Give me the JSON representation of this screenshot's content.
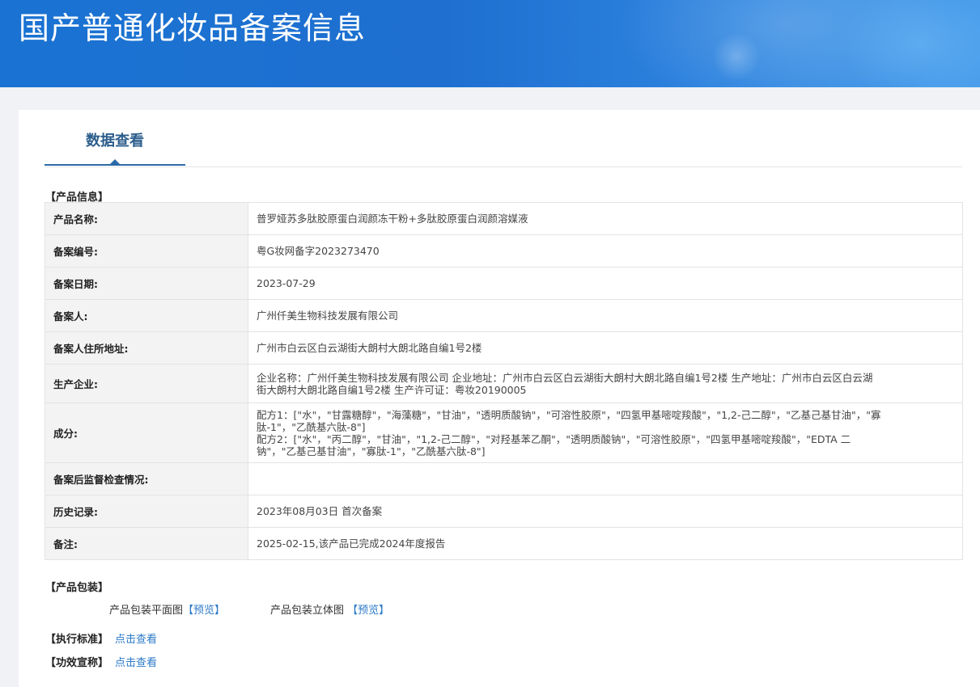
{
  "header": {
    "title": "国产普通化妆品备案信息"
  },
  "tabs": {
    "active_label": "数据查看"
  },
  "product_info": {
    "section_title": "【产品信息】",
    "rows": [
      {
        "label": "产品名称:",
        "value": "普罗娅苏多肽胶原蛋白润颜冻干粉+多肽胶原蛋白润颜溶媒液"
      },
      {
        "label": "备案编号:",
        "value": "粤G妆网备字2023273470"
      },
      {
        "label": "备案日期:",
        "value": "2023-07-29"
      },
      {
        "label": "备案人:",
        "value": "广州仟美生物科技发展有限公司"
      },
      {
        "label": "备案人住所地址:",
        "value": "广州市白云区白云湖街大朗村大朗北路自编1号2楼"
      },
      {
        "label": "生产企业:",
        "value_lines": [
          "企业名称：广州仟美生物科技发展有限公司 企业地址：广州市白云区白云湖街大朗村大朗北路自编1号2楼 生产地址：广州市白云区白云湖",
          "街大朗村大朗北路自编1号2楼 生产许可证：粤妆20190005"
        ]
      },
      {
        "label": "成分:",
        "value_lines": [
          "配方1：[\"水\"，\"甘露糖醇\"，\"海藻糖\"，\"甘油\"，\"透明质酸钠\"，\"可溶性胶原\"，\"四氢甲基嘧啶羧酸\"，\"1,2-己二醇\"，\"乙基己基甘油\"，\"寡",
          "肽-1\"，\"乙酰基六肽-8\"]",
          "配方2：[\"水\"，\"丙二醇\"，\"甘油\"，\"1,2-己二醇\"，\"对羟基苯乙酮\"，\"透明质酸钠\"，\"可溶性胶原\"，\"四氢甲基嘧啶羧酸\"，\"EDTA 二",
          "钠\"，\"乙基己基甘油\"，\"寡肽-1\"，\"乙酰基六肽-8\"]"
        ]
      },
      {
        "label": "备案后监督检查情况:",
        "value": ""
      },
      {
        "label": "历史记录:",
        "value": "2023年08月03日 首次备案"
      },
      {
        "label": "备注:",
        "value": "2025-02-15,该产品已完成2024年度报告"
      }
    ]
  },
  "packaging": {
    "section_title": "【产品包装】",
    "flat_label": "产品包装平面图",
    "flat_link": "【预览】",
    "solid_label": "产品包装立体图",
    "solid_link": "【预览】"
  },
  "standard": {
    "label": "【执行标准】",
    "link": "点击查看"
  },
  "efficacy": {
    "label": "【功效宣称】",
    "link": "点击查看"
  }
}
